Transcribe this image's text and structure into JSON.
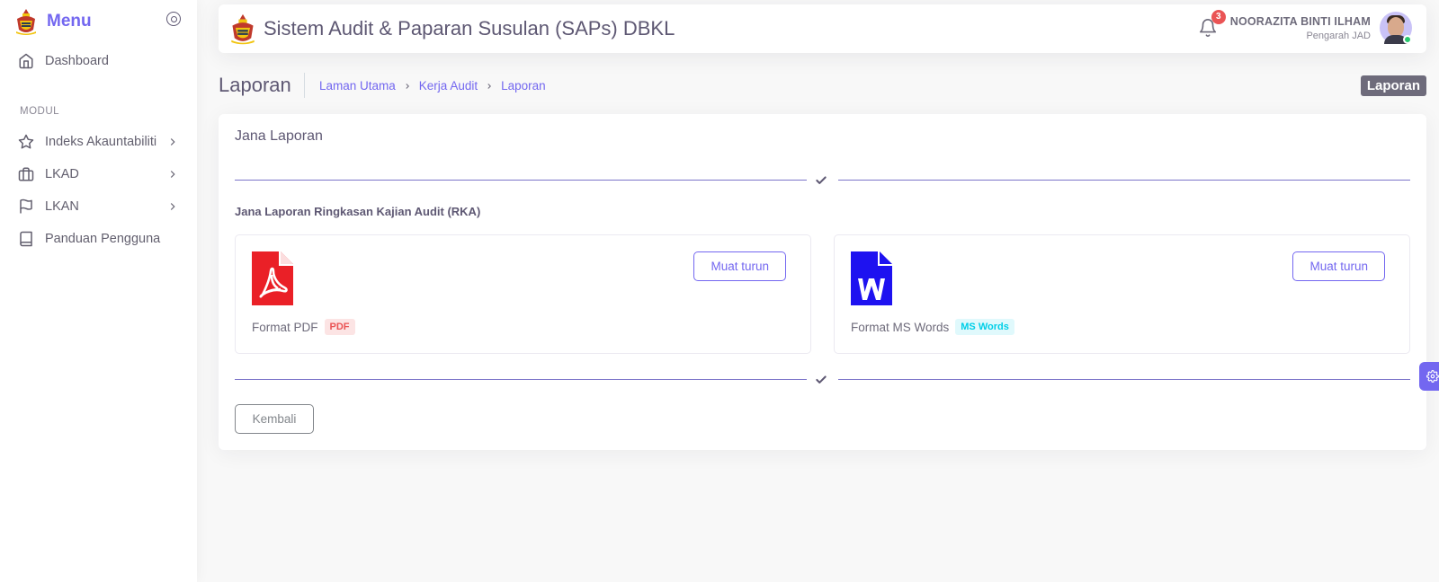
{
  "sidebar": {
    "title": "Menu",
    "dashboard": "Dashboard",
    "section_header": "MODUL",
    "items": [
      {
        "label": "Indeks Akauntabiliti",
        "icon": "star-icon"
      },
      {
        "label": "LKAD",
        "icon": "briefcase-icon"
      },
      {
        "label": "LKAN",
        "icon": "flag-icon"
      },
      {
        "label": "Panduan Pengguna",
        "icon": "book-icon"
      }
    ]
  },
  "navbar": {
    "app_title": "Sistem Audit & Paparan Susulan (SAPs) DBKL",
    "notification_count": "3",
    "user_name": "NOORAZITA BINTI ILHAM",
    "user_role": "Pengarah JAD"
  },
  "page": {
    "title": "Laporan",
    "breadcrumb": [
      "Laman Utama",
      "Kerja Audit",
      "Laporan"
    ],
    "chip": "Laporan"
  },
  "card": {
    "title": "Jana Laporan",
    "section_label": "Jana Laporan Ringkasan Kajian Audit (RKA)",
    "downloads": [
      {
        "format_label": "Format PDF",
        "badge": "PDF",
        "button": "Muat turun",
        "icon": "pdf-file-icon"
      },
      {
        "format_label": "Format MS Words",
        "badge": "MS Words",
        "button": "Muat turun",
        "icon": "word-file-icon"
      }
    ],
    "back_button": "Kembali"
  },
  "colors": {
    "primary": "#7367f0",
    "pdf_red": "#ea2027",
    "word_blue": "#1e12f0",
    "danger": "#ea5455",
    "success": "#28c76f"
  }
}
